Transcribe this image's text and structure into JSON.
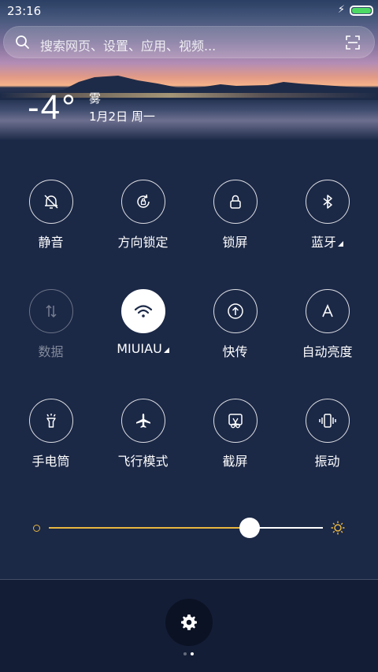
{
  "status_bar": {
    "time": "23:16",
    "charging_symbol": "⚡"
  },
  "search": {
    "placeholder": "搜索网页、设置、应用、视频..."
  },
  "weather": {
    "temperature": "-4°",
    "condition": "雾",
    "date": "1月2日 周一"
  },
  "toggles": [
    {
      "label": "静音",
      "icon": "bell-off-icon",
      "state": "off"
    },
    {
      "label": "方向锁定",
      "icon": "rotation-lock-icon",
      "state": "off"
    },
    {
      "label": "锁屏",
      "icon": "lock-icon",
      "state": "off"
    },
    {
      "label": "蓝牙",
      "icon": "bluetooth-icon",
      "state": "off",
      "has_submenu": true
    },
    {
      "label": "数据",
      "icon": "mobile-data-icon",
      "state": "disabled"
    },
    {
      "label": "MIUIAU",
      "icon": "wifi-icon",
      "state": "on",
      "has_submenu": true
    },
    {
      "label": "快传",
      "icon": "quick-transfer-icon",
      "state": "off"
    },
    {
      "label": "自动亮度",
      "icon": "auto-brightness-icon",
      "state": "off"
    },
    {
      "label": "手电筒",
      "icon": "flashlight-icon",
      "state": "off"
    },
    {
      "label": "飞行模式",
      "icon": "airplane-icon",
      "state": "off"
    },
    {
      "label": "截屏",
      "icon": "screenshot-icon",
      "state": "off"
    },
    {
      "label": "振动",
      "icon": "vibrate-icon",
      "state": "off"
    }
  ],
  "brightness": {
    "level": 0.73,
    "accent_color": "#e8b640"
  },
  "pager": {
    "pages": 2,
    "current": 2
  },
  "colors": {
    "panel_bg": "#1b2846",
    "bottom_bg": "#131d36",
    "active_toggle": "#ffffff"
  }
}
